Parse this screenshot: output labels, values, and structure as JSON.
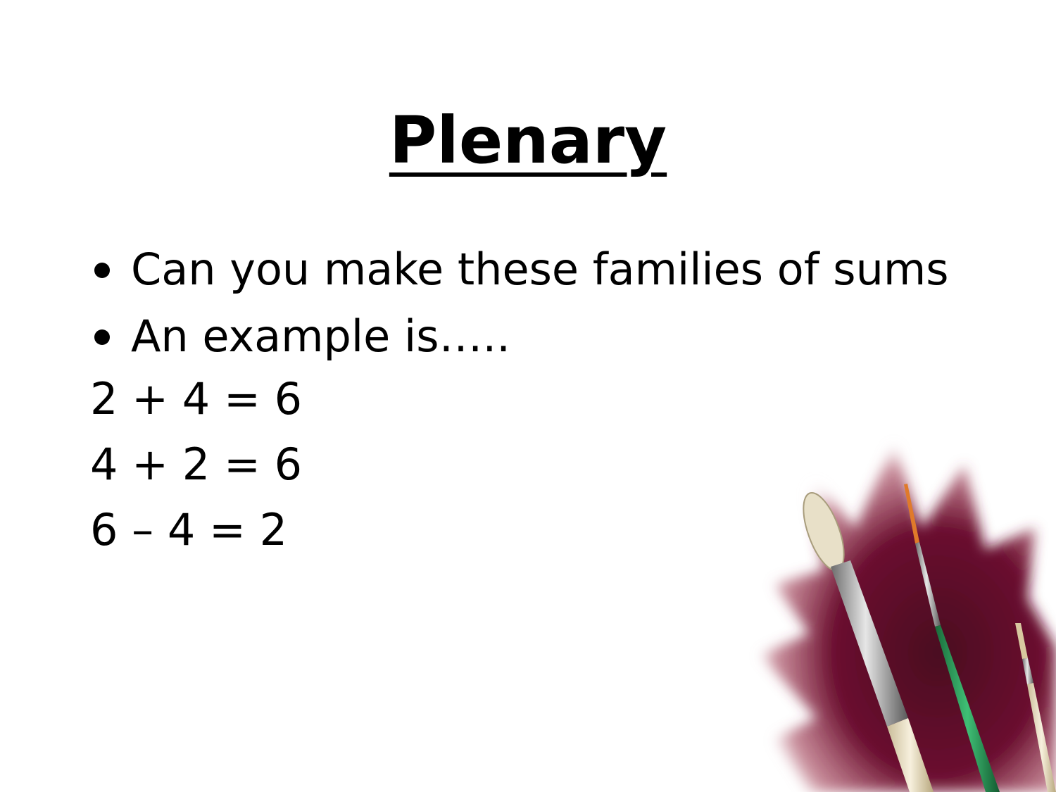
{
  "slide": {
    "title": "Plenary",
    "bullets": [
      "Can you make these families of sums",
      "An example is….."
    ],
    "sums": [
      "2 + 4 = 6",
      "4 + 2 = 6",
      "6 – 4 = 2"
    ],
    "decoration": {
      "icon": "paintbrushes-icon",
      "splash_color": "#6b1030",
      "brush_handle_colors": [
        "#efe6cf",
        "#2f9a5a",
        "#d9c9a0"
      ]
    }
  }
}
